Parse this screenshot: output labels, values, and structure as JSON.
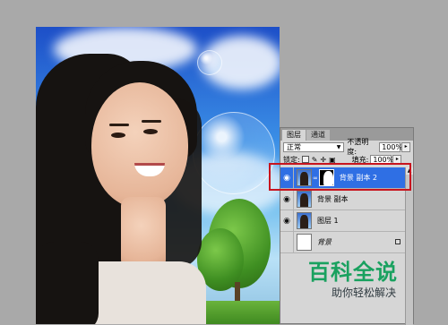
{
  "layers_panel": {
    "tabs": [
      "图层",
      "通道"
    ],
    "blend_mode": "正常",
    "opacity_label": "不透明度:",
    "opacity_value": "100%",
    "lock_label": "锁定:",
    "fill_label": "填充:",
    "fill_value": "100%",
    "layers": [
      {
        "name": "背景 副本 2",
        "visible": true,
        "selected": true,
        "has_mask": true
      },
      {
        "name": "背景 副本",
        "visible": true,
        "selected": false,
        "has_mask": false
      },
      {
        "name": "图层 1",
        "visible": true,
        "selected": false,
        "has_mask": false
      },
      {
        "name": "背景",
        "visible": false,
        "selected": false,
        "has_mask": false,
        "locked": true
      }
    ]
  },
  "watermark": {
    "title": "百科全说",
    "subtitle": "助你轻松解决"
  },
  "colors": {
    "selection": "#2f6fe4",
    "highlight_box": "#c8141e",
    "watermark_green": "#19a15f"
  },
  "icons": [
    "eye-icon",
    "chain-link-icon",
    "lock-icon"
  ]
}
